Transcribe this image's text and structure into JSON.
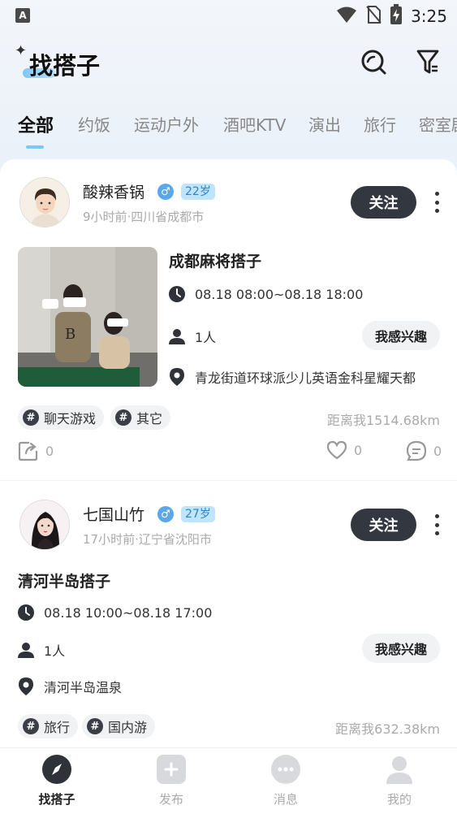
{
  "status_bar": {
    "app_icon": "A",
    "time": "3:25",
    "icons": [
      "wifi-icon",
      "no-sim-icon",
      "battery-charging-icon"
    ]
  },
  "header": {
    "title": "找搭子",
    "sparkle": "✦",
    "buttons": [
      "search-icon",
      "filter-icon"
    ]
  },
  "tabs": [
    {
      "label": "全部",
      "active": true
    },
    {
      "label": "约饭"
    },
    {
      "label": "运动户外"
    },
    {
      "label": "酒吧KTV"
    },
    {
      "label": "演出"
    },
    {
      "label": "旅行"
    },
    {
      "label": "密室剧"
    }
  ],
  "posts": [
    {
      "user": {
        "name": "酸辣香锅",
        "gender": "♂",
        "age": "22岁",
        "meta": "9小时前·四川省成都市"
      },
      "follow_label": "关注",
      "title": "成都麻将搭子",
      "time": "08.18 08:00~08.18 18:00",
      "people": "1人",
      "location": "青龙街道环球派少儿英语金科星耀天都",
      "interest_label": "我感兴趣",
      "tags": [
        "聊天游戏",
        "其它"
      ],
      "tag_symbol": "#",
      "distance": "距离我1514.68km",
      "shares": "0",
      "likes": "0",
      "comments": "0"
    },
    {
      "user": {
        "name": "七国山竹",
        "gender": "♂",
        "age": "27岁",
        "meta": "17小时前·辽宁省沈阳市"
      },
      "follow_label": "关注",
      "title": "清河半岛搭子",
      "time": "08.18 10:00~08.18 17:00",
      "people": "1人",
      "location": "清河半岛温泉",
      "interest_label": "我感兴趣",
      "tags": [
        "旅行",
        "国内游"
      ],
      "tag_symbol": "#",
      "distance": "距离我632.38km"
    }
  ],
  "bottom_nav": [
    {
      "label": "找搭子",
      "icon": "compass-icon",
      "active": true
    },
    {
      "label": "发布",
      "icon": "plus-square-icon"
    },
    {
      "label": "消息",
      "icon": "chat-bubble-icon"
    },
    {
      "label": "我的",
      "icon": "person-icon"
    }
  ],
  "colors": {
    "accent": "#7fc6f4",
    "follow_button": "#333840",
    "badge_blue": "#5aa8e8",
    "age_badge_bg": "#bfe4fb"
  }
}
